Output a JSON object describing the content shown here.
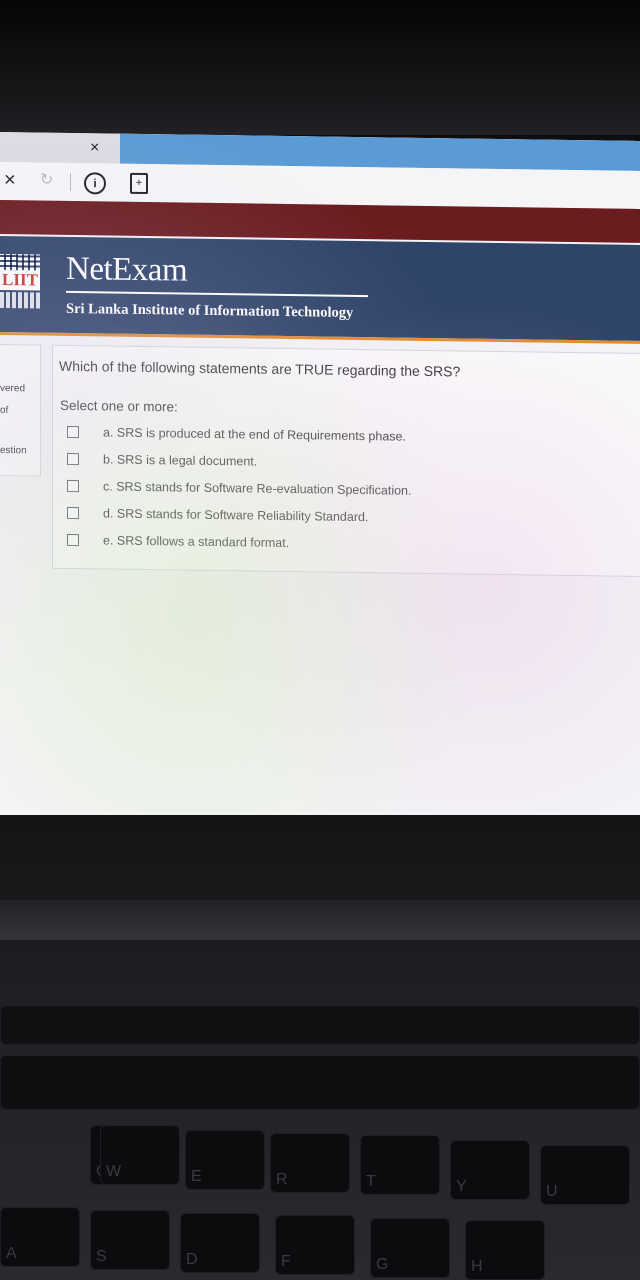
{
  "browser": {
    "tab_close": "×",
    "stop_icon": "×",
    "reload_icon": "↻",
    "info_icon": "i",
    "page_icon": "+"
  },
  "header": {
    "logo_text": "LIIT",
    "brand": "NetExam",
    "subtitle": "Sri Lanka Institute of Information Technology"
  },
  "sidebar": {
    "line1": "vered",
    "line2": "of",
    "line3": "estion"
  },
  "question": {
    "text": "Which of the following statements are TRUE regarding the SRS?",
    "prompt": "Select one or more:",
    "options": [
      {
        "label": "a. SRS is produced at the end of Requirements phase.",
        "checked": false
      },
      {
        "label": "b. SRS is a legal document.",
        "checked": false
      },
      {
        "label": "c. SRS stands for Software Re-evaluation Specification.",
        "checked": false
      },
      {
        "label": "d. SRS stands for Software Reliability Standard.",
        "checked": false
      },
      {
        "label": "e. SRS follows a standard format.",
        "checked": false
      }
    ]
  },
  "keyboard": {
    "keys": [
      "Q",
      "W",
      "E",
      "R",
      "T",
      "Y",
      "U",
      "A",
      "S",
      "D",
      "F",
      "G",
      "H"
    ]
  },
  "colors": {
    "header_bg": "#2e4468",
    "header_accent": "#e08c2e",
    "maroon_bar": "#6b1c1f",
    "tab_blue": "#5b9bd5"
  }
}
